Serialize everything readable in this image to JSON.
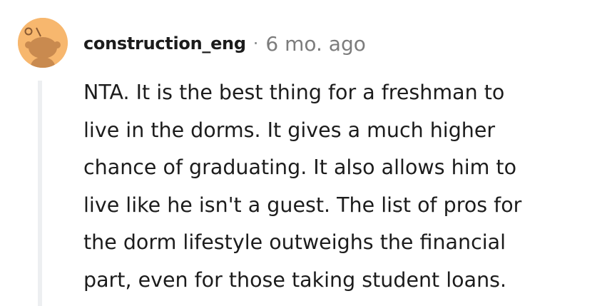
{
  "comment": {
    "author": "construction_eng",
    "separator": "·",
    "age": "6 mo. ago",
    "avatar_icon": "snoo-avatar-icon",
    "avatar_color": "#f7b76e",
    "lines": [
      "NTA. It is the best thing for a freshman to",
      "live in the dorms. It gives a much higher",
      "chance of graduating. It also allows him to",
      "live like he isn't a guest. The list of pros for",
      "the dorm lifestyle outweighs the financial",
      "part, even for those taking student loans."
    ]
  }
}
